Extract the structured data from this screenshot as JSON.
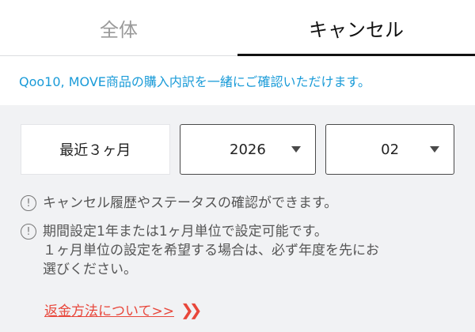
{
  "tabs": [
    {
      "label": "全体",
      "active": false
    },
    {
      "label": "キャンセル",
      "active": true
    }
  ],
  "notice": "Qoo10, MOVE商品の購入内訳を一緒にご確認いただけます。",
  "filters": {
    "period": "最近３ヶ月",
    "year": "2026",
    "month": "02"
  },
  "info": {
    "line1": "キャンセル履歴やステータスの確認ができます。",
    "line2a": "期間設定1年または1ヶ月単位で設定可能です。",
    "line2b": "１ヶ月単位の設定を希望する場合は、必ず年度を先にお",
    "line2c": "選びください。",
    "icon_glyph": "!"
  },
  "refund_link": "返金方法について>>",
  "colors": {
    "accent": "#1a9bd8",
    "link": "#e8473b",
    "background": "#f1f2f4"
  },
  "icons": {
    "info": "exclamation-circle-icon",
    "dropdown": "caret-down-icon",
    "refund": "double-chevron-right-icon"
  }
}
